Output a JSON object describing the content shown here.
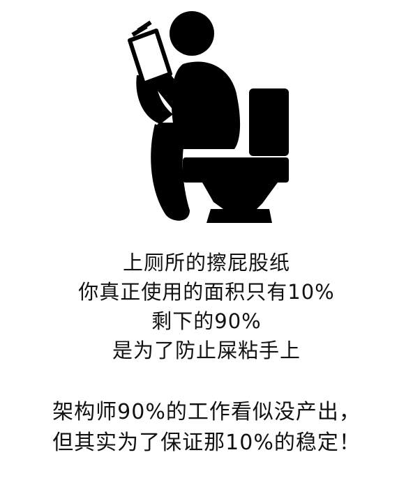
{
  "pictogram": {
    "icon": "person-reading-on-toilet-icon",
    "color": "#000000"
  },
  "caption_top": {
    "lines": [
      "上厕所的擦屁股纸",
      "你真正使用的面积只有10%",
      "剩下的90%",
      "是为了防止屎粘手上"
    ]
  },
  "caption_bottom": {
    "lines": [
      "架构师90%的工作看似没产出，",
      "但其实为了保证那10%的稳定！"
    ]
  }
}
